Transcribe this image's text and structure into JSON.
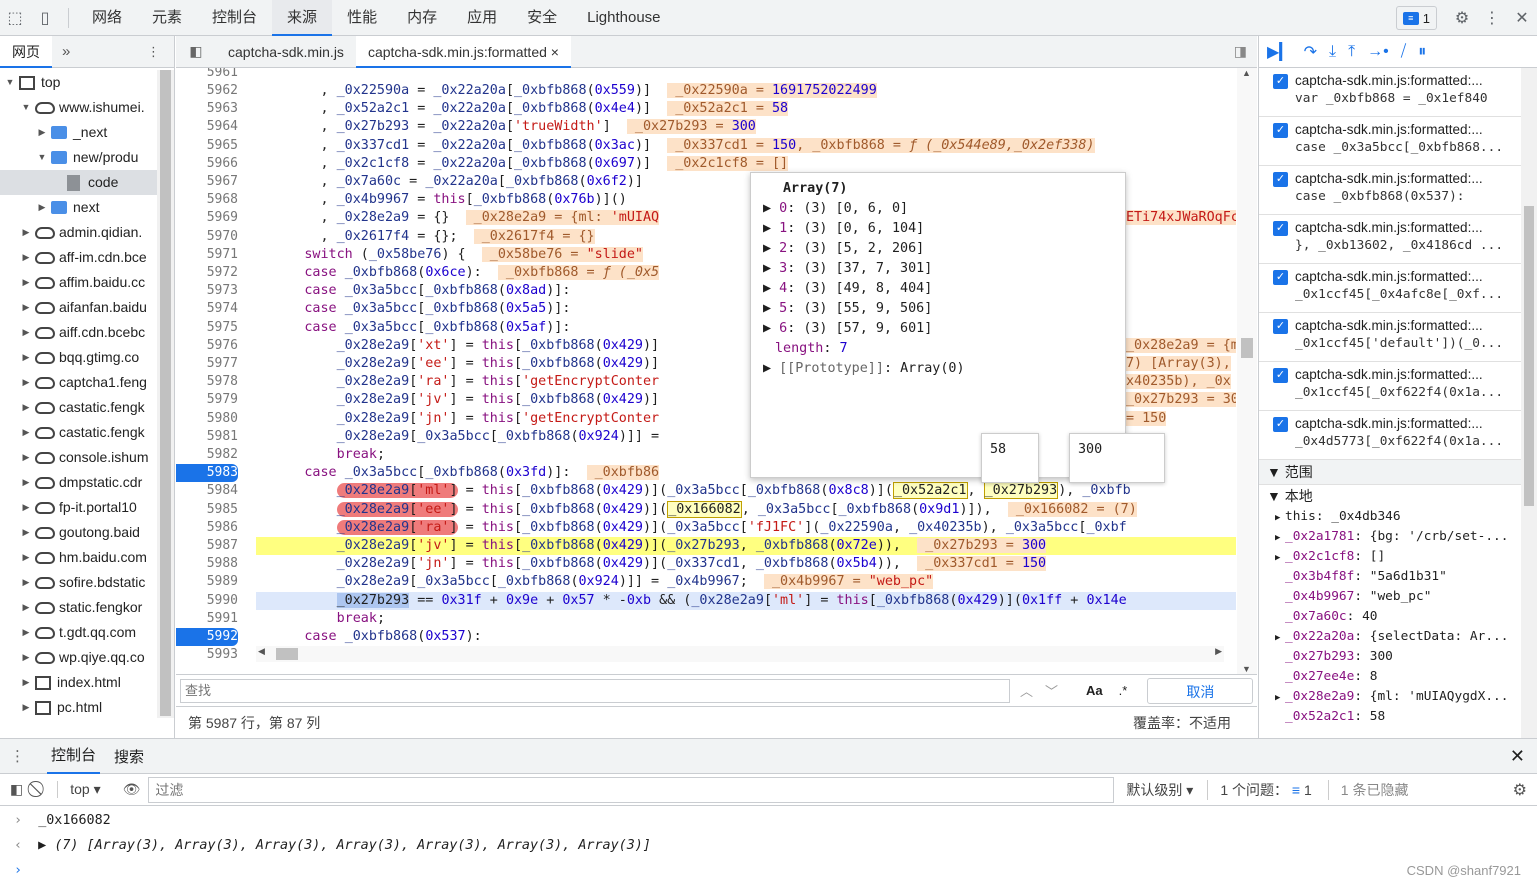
{
  "topbar": {
    "tabs": [
      "网络",
      "元素",
      "控制台",
      "来源",
      "性能",
      "内存",
      "应用",
      "安全",
      "Lighthouse"
    ],
    "active_tab": "来源",
    "issues_count": "1"
  },
  "navigator": {
    "tab": "网页",
    "more": "»",
    "items": [
      {
        "label": "top",
        "type": "box",
        "indent": 0,
        "arrow": "▼"
      },
      {
        "label": "www.ishumei.",
        "type": "cloud",
        "indent": 1,
        "arrow": "▼"
      },
      {
        "label": "_next",
        "type": "folder",
        "indent": 2,
        "arrow": "▶"
      },
      {
        "label": "new/produ",
        "type": "folder",
        "indent": 2,
        "arrow": "▼"
      },
      {
        "label": "code",
        "type": "file",
        "indent": 3,
        "arrow": "",
        "selected": true
      },
      {
        "label": "next",
        "type": "folder",
        "indent": 2,
        "arrow": "▶"
      },
      {
        "label": "admin.qidian.",
        "type": "cloud",
        "indent": 1,
        "arrow": "▶"
      },
      {
        "label": "aff-im.cdn.bce",
        "type": "cloud",
        "indent": 1,
        "arrow": "▶"
      },
      {
        "label": "affim.baidu.cc",
        "type": "cloud",
        "indent": 1,
        "arrow": "▶"
      },
      {
        "label": "aifanfan.baidu",
        "type": "cloud",
        "indent": 1,
        "arrow": "▶"
      },
      {
        "label": "aiff.cdn.bcebc",
        "type": "cloud",
        "indent": 1,
        "arrow": "▶"
      },
      {
        "label": "bqq.gtimg.co",
        "type": "cloud",
        "indent": 1,
        "arrow": "▶"
      },
      {
        "label": "captcha1.feng",
        "type": "cloud",
        "indent": 1,
        "arrow": "▶"
      },
      {
        "label": "castatic.fengk",
        "type": "cloud",
        "indent": 1,
        "arrow": "▶"
      },
      {
        "label": "castatic.fengk",
        "type": "cloud",
        "indent": 1,
        "arrow": "▶"
      },
      {
        "label": "console.ishum",
        "type": "cloud",
        "indent": 1,
        "arrow": "▶"
      },
      {
        "label": "dmpstatic.cdr",
        "type": "cloud",
        "indent": 1,
        "arrow": "▶"
      },
      {
        "label": "fp-it.portal10",
        "type": "cloud",
        "indent": 1,
        "arrow": "▶"
      },
      {
        "label": "goutong.baid",
        "type": "cloud",
        "indent": 1,
        "arrow": "▶"
      },
      {
        "label": "hm.baidu.com",
        "type": "cloud",
        "indent": 1,
        "arrow": "▶"
      },
      {
        "label": "sofire.bdstatic",
        "type": "cloud",
        "indent": 1,
        "arrow": "▶"
      },
      {
        "label": "static.fengkor",
        "type": "cloud",
        "indent": 1,
        "arrow": "▶"
      },
      {
        "label": "t.gdt.qq.com",
        "type": "cloud",
        "indent": 1,
        "arrow": "▶"
      },
      {
        "label": "wp.qiye.qq.co",
        "type": "cloud",
        "indent": 1,
        "arrow": "▶"
      },
      {
        "label": "index.html",
        "type": "box",
        "indent": 1,
        "arrow": "▶"
      },
      {
        "label": "pc.html",
        "type": "box",
        "indent": 1,
        "arrow": "▶"
      }
    ]
  },
  "editor": {
    "tabs": [
      "captcha-sdk.min.js",
      "captcha-sdk.min.js:formatted"
    ],
    "active_tab_index": 1,
    "close_glyph": "×",
    "lines": [
      {
        "no": "5962",
        "html": "        , <span class='v'>_0x22590a</span> = <span class='v'>_0x22a20a</span>[<span class='v'>_0xbfb868</span>(<span class='n'>0x559</span>)]  <span class='ov'> _0x22590a = <span class='n'>1691752022499</span></span>"
      },
      {
        "no": "5963",
        "html": "        , <span class='v'>_0x52a2c1</span> = <span class='v'>_0x22a20a</span>[<span class='v'>_0xbfb868</span>(<span class='n'>0x4e4</span>)]  <span class='ov'> _0x52a2c1 = <span class='n'>58</span></span>"
      },
      {
        "no": "5964",
        "html": "        , <span class='v'>_0x27b293</span> = <span class='v'>_0x22a20a</span>[<span class='s'>'trueWidth'</span>]  <span class='ov'> _0x27b293 = <span class='n'>300</span></span>"
      },
      {
        "no": "5965",
        "html": "        , <span class='v'>_0x337cd1</span> = <span class='v'>_0x22a20a</span>[<span class='v'>_0xbfb868</span>(<span class='n'>0x3ac</span>)]  <span class='ov'> _0x337cd1 = <span class='n'>150</span>, _0xbfb868 = <i>ƒ (_0x544e89,_0x2ef338)</i></span>"
      },
      {
        "no": "5966",
        "html": "        , <span class='v'>_0x2c1cf8</span> = <span class='v'>_0x22a20a</span>[<span class='v'>_0xbfb868</span>(<span class='n'>0x697</span>)]  <span class='ov'> _0x2c1cf8 = []</span>"
      },
      {
        "no": "5967",
        "html": "        , <span class='v'>_0x7a60c</span> = <span class='v'>_0x22a20a</span>[<span class='v'>_0xbfb868</span>(<span class='n'>0x6f2</span>)]"
      },
      {
        "no": "5968",
        "html": "        , <span class='v'>_0x4b9967</span> = <span class='k'>this</span>[<span class='v'>_0xbfb868</span>(<span class='n'>0x76b</span>)]()"
      },
      {
        "no": "5969",
        "html": "        , <span class='v'>_0x28e2a9</span> = {}  <span class='ov'> _0x28e2a9 = {ml: <span class='s'>'mUIAQ</span></span>"
      },
      {
        "no": "5970",
        "html": "        , <span class='v'>_0x2617f4</span> = {};  <span class='ov'> _0x2617f4 = {}</span>"
      },
      {
        "no": "5971",
        "html": "      <span class='k'>switch</span> (<span class='v'>_0x58be76</span>) {  <span class='ov'> _0x58be76 = <span class='s'>\"slide\"</span></span>"
      },
      {
        "no": "5972",
        "html": "      <span class='k'>case</span> <span class='v'>_0xbfb868</span>(<span class='n'>0x6ce</span>):  <span class='ov'> _0xbfb868 = <i>ƒ (_0x5</i></span>"
      },
      {
        "no": "5973",
        "html": "      <span class='k'>case</span> <span class='v'>_0x3a5bcc</span>[<span class='v'>_0xbfb868</span>(<span class='n'>0x8ad</span>)]:"
      },
      {
        "no": "5974",
        "html": "      <span class='k'>case</span> <span class='v'>_0x3a5bcc</span>[<span class='v'>_0xbfb868</span>(<span class='n'>0x5a5</span>)]:"
      },
      {
        "no": "5975",
        "html": "      <span class='k'>case</span> <span class='v'>_0x3a5bcc</span>[<span class='v'>_0xbfb868</span>(<span class='n'>0x5af</span>)]:"
      },
      {
        "no": "5976",
        "html": "          <span class='v'>_0x28e2a9</span>[<span class='s'>'xt'</span>] = <span class='k'>this</span>[<span class='v'>_0xbfb868</span>(<span class='n'>0x429</span>)]"
      },
      {
        "no": "5977",
        "html": "          <span class='v'>_0x28e2a9</span>[<span class='s'>'ee'</span>] = <span class='k'>this</span>[<span class='v'>_0xbfb868</span>(<span class='n'>0x429</span>)]"
      },
      {
        "no": "5978",
        "html": "          <span class='v'>_0x28e2a9</span>[<span class='s'>'ra'</span>] = <span class='k'>this</span>[<span class='s'>'getEncryptConter</span>"
      },
      {
        "no": "5979",
        "html": "          <span class='v'>_0x28e2a9</span>[<span class='s'>'jv'</span>] = <span class='k'>this</span>[<span class='v'>_0xbfb868</span>(<span class='n'>0x429</span>)]"
      },
      {
        "no": "5980",
        "html": "          <span class='v'>_0x28e2a9</span>[<span class='s'>'jn'</span>] = <span class='k'>this</span>[<span class='s'>'getEncryptConter</span>"
      },
      {
        "no": "5981",
        "html": "          <span class='v'>_0x28e2a9</span>[<span class='v'>_0x3a5bcc</span>[<span class='v'>_0xbfb868</span>(<span class='n'>0x924</span>)]] ="
      },
      {
        "no": "5982",
        "html": "          <span class='k'>break</span>;"
      },
      {
        "no": "5983",
        "html": "      <span class='k'>case</span> <span class='v'>_0x3a5bcc</span>[<span class='v'>_0xbfb868</span>(<span class='n'>0x3fd</span>)]:  <span class='ov'> _0xbfb86</span>",
        "bp": true
      },
      {
        "no": "5984",
        "html": "          <span class='red'><span class='v'>_0x28e2a9</span>[<span class='s'>'ml'</span>]</span> = <span class='k'>this</span>[<span class='v'>_0xbfb868</span>(<span class='n'>0x429</span>)](<span class='v'>_0x3a5bcc</span>[<span class='v'>_0xbfb868</span>(<span class='n'>0x8c8</span>)](<span class='hl'>_0x52a2c1</span>, <span class='hl'>_0x27b293</span>), <span class='v'>_0xbfb</span>"
      },
      {
        "no": "5985",
        "html": "          <span class='red'><span class='v'>_0x28e2a9</span>[<span class='s'>'ee'</span>]</span> = <span class='k'>this</span>[<span class='v'>_0xbfb868</span>(<span class='n'>0x429</span>)](<span class='hl'>_0x166082</span>, <span class='v'>_0x3a5bcc</span>[<span class='v'>_0xbfb868</span>(<span class='n'>0x9d1</span>)]),  <span class='ov'> _0x166082 = (7)</span>"
      },
      {
        "no": "5986",
        "html": "          <span class='red'><span class='v'>_0x28e2a9</span>[<span class='s'>'ra'</span>]</span> = <span class='k'>this</span>[<span class='v'>_0xbfb868</span>(<span class='n'>0x429</span>)](<span class='v'>_0x3a5bcc</span>[<span class='s'>'fJ1FC'</span>](<span class='v'>_0x22590a</span>, <span class='v'>_0x40235b</span>), <span class='v'>_0x3a5bcc</span>[<span class='v'>_0xbf</span>"
      },
      {
        "no": "5987",
        "html": "          <span class='v'>_0x28e2a9</span>[<span class='s'>'jv'</span>] = <span class='k'>this</span>[<span class='v'>_0xbfb868</span>(<span class='n'>0x429</span>)](<span class='v'>_0x27b293</span>, <span class='v'>_0xbfb868</span>(<span class='n'>0x72e</span>)),  <span class='ov'> _0x27b293 = <span class='n'>300</span></span>",
        "yellow": true
      },
      {
        "no": "5988",
        "html": "          <span class='v'>_0x28e2a9</span>[<span class='s'>'jn'</span>] = <span class='k'>this</span>[<span class='v'>_0xbfb868</span>(<span class='n'>0x429</span>)](<span class='v'>_0x337cd1</span>, <span class='v'>_0xbfb868</span>(<span class='n'>0x5b4</span>)),  <span class='ov'> _0x337cd1 = <span class='n'>150</span></span>"
      },
      {
        "no": "5989",
        "html": "          <span class='v'>_0x28e2a9</span>[<span class='v'>_0x3a5bcc</span>[<span class='v'>_0xbfb868</span>(<span class='n'>0x924</span>)]] = <span class='v'>_0x4b9967</span>;  <span class='ov'> _0x4b9967 = <span class='s'>\"web_pc\"</span></span>"
      },
      {
        "no": "5990",
        "html": "          <span class='sel2'>_0x27b293</span> == <span class='n'>0x31f</span> + <span class='n'>0x9e</span> + <span class='n'>0x57</span> * -<span class='n'>0xb</span> &amp;&amp; (<span class='v'>_0x28e2a9</span>[<span class='s'>'ml'</span>] = <span class='k'>this</span>[<span class='v'>_0xbfb868</span>(<span class='n'>0x429</span>)](<span class='n'>0x1ff</span> + <span class='n'>0x14e</span>",
        "blue": true
      },
      {
        "no": "5991",
        "html": "          <span class='k'>break</span>;"
      },
      {
        "no": "5992",
        "html": "      <span class='k'>case</span> <span class='v'>_0xbfb868</span>(<span class='n'>0x537</span>):",
        "bp": true
      },
      {
        "no": "5993",
        "html": ""
      }
    ],
    "side_values": [
      {
        "row": 14,
        "text": "_0x28e2a9 = {ml"
      },
      {
        "row": 15,
        "text": "7) [Array(3),"
      },
      {
        "row": 16,
        "text": "x40235b), _0x"
      },
      {
        "row": 17,
        "text": "_0x27b293 = 300"
      },
      {
        "row": 18,
        "text": "= 150"
      }
    ],
    "right_overflow": "ETi74xJWaROqFc",
    "top_partial": "5961"
  },
  "array_popup": {
    "title": "Array(7)",
    "items": [
      {
        "idx": "0",
        "val": "(3) [0, 6, 0]"
      },
      {
        "idx": "1",
        "val": "(3) [0, 6, 104]"
      },
      {
        "idx": "2",
        "val": "(3) [5, 2, 206]"
      },
      {
        "idx": "3",
        "val": "(3) [37, 7, 301]"
      },
      {
        "idx": "4",
        "val": "(3) [49, 8, 404]"
      },
      {
        "idx": "5",
        "val": "(3) [55, 9, 506]"
      },
      {
        "idx": "6",
        "val": "(3) [57, 9, 601]"
      }
    ],
    "length_label": "length",
    "length_value": "7",
    "prototype_label": "[[Prototype]]",
    "prototype_value": "Array(0)"
  },
  "tooltips": [
    {
      "value": "58"
    },
    {
      "value": "300"
    }
  ],
  "search": {
    "placeholder": "查找",
    "match_case": "Aa",
    "regex": ".*",
    "cancel": "取消"
  },
  "status": {
    "position": "第 5987 行，第 87 列",
    "coverage": "覆盖率：不适用"
  },
  "breakpoints": [
    {
      "file": "captcha-sdk.min.js:formatted:...",
      "code": "var _0xbfb868 = _0x1ef840"
    },
    {
      "file": "captcha-sdk.min.js:formatted:...",
      "code": "case _0x3a5bcc[_0xbfb868..."
    },
    {
      "file": "captcha-sdk.min.js:formatted:...",
      "code": "case _0xbfb868(0x537):"
    },
    {
      "file": "captcha-sdk.min.js:formatted:...",
      "code": "}, _0xb13602, _0x4186cd ..."
    },
    {
      "file": "captcha-sdk.min.js:formatted:...",
      "code": "_0x1ccf45[_0x4afc8e[_0xf..."
    },
    {
      "file": "captcha-sdk.min.js:formatted:...",
      "code": "_0x1ccf45['default'])(_0..."
    },
    {
      "file": "captcha-sdk.min.js:formatted:...",
      "code": "_0x1ccf45[_0xf622f4(0x1a..."
    },
    {
      "file": "captcha-sdk.min.js:formatted:...",
      "code": "_0x4d5773[_0xf622f4(0x1a..."
    }
  ],
  "scope": {
    "title": "范围",
    "local": "本地",
    "rows": [
      {
        "arrow": "▶",
        "key": "this",
        "val": "_0x4db346",
        "plain": true
      },
      {
        "arrow": "▶",
        "key": "_0x2a1781",
        "val": "{bg: '/crb/set-..."
      },
      {
        "arrow": "▶",
        "key": "_0x2c1cf8",
        "val": "[]"
      },
      {
        "arrow": "",
        "key": "_0x3b4f8f",
        "val": "\"5a6d1b31\""
      },
      {
        "arrow": "",
        "key": "_0x4b9967",
        "val": "\"web_pc\""
      },
      {
        "arrow": "",
        "key": "_0x7a60c",
        "val": "40"
      },
      {
        "arrow": "▶",
        "key": "_0x22a20a",
        "val": "{selectData: Ar..."
      },
      {
        "arrow": "",
        "key": "_0x27b293",
        "val": "300"
      },
      {
        "arrow": "",
        "key": "_0x27ee4e",
        "val": "8"
      },
      {
        "arrow": "▶",
        "key": "_0x28e2a9",
        "val": "{ml: 'mUIAQygdX..."
      },
      {
        "arrow": "",
        "key": "_0x52a2c1",
        "val": "58"
      }
    ]
  },
  "console": {
    "tabs": [
      "控制台",
      "搜索"
    ],
    "context": "top",
    "filter_placeholder": "过滤",
    "level": "默认级别",
    "issues": "1 个问题：",
    "issues_count": "1",
    "hidden": "1 条已隐藏",
    "input_echo": "_0x166082",
    "output": "(7) [Array(3), Array(3), Array(3), Array(3), Array(3), Array(3), Array(3)]",
    "watermark": "CSDN @shanf7921"
  }
}
